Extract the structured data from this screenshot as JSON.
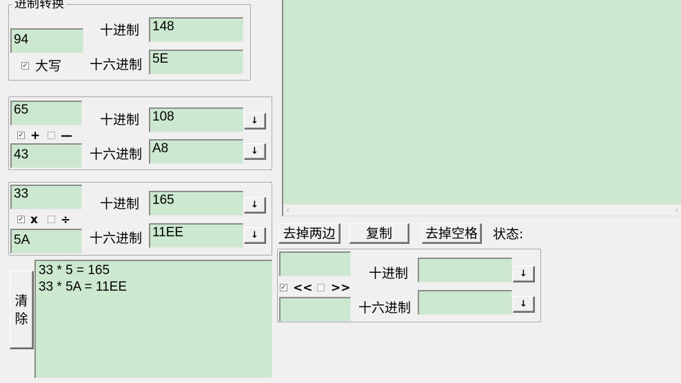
{
  "group1": {
    "title": "进制转换",
    "input": "94",
    "uppercase_checked": true,
    "uppercase_label": "大写",
    "decimal_label": "十进制",
    "decimal_value": "148",
    "hex_label": "十六进制",
    "hex_value": "5E"
  },
  "group2": {
    "input_a": "65",
    "input_b": "43",
    "plus_checked": true,
    "plus_label": "+",
    "minus_checked": false,
    "minus_label": "—",
    "decimal_label": "十进制",
    "decimal_value": "108",
    "hex_label": "十六进制",
    "hex_value": "A8",
    "down_label": "↓"
  },
  "group3": {
    "input_a": "33",
    "input_b": "5A",
    "mul_checked": true,
    "mul_label": "x",
    "div_checked": false,
    "div_label": "÷",
    "decimal_label": "十进制",
    "decimal_value": "165",
    "hex_label": "十六进制",
    "hex_value": "11EE",
    "down_label": "↓"
  },
  "log": {
    "clear_label_1": "清",
    "clear_label_2": "除",
    "text": "33 * 5 = 165\n33 * 5A = 11EE"
  },
  "right_panel": {
    "scroll_left": "‹",
    "scroll_right": "›"
  },
  "toolbar": {
    "strip_edges_label": "去掉两边",
    "copy_label": "复制",
    "strip_spaces_label": "去掉空格",
    "status_label": "状态:"
  },
  "group4": {
    "input_a": "",
    "input_b": "",
    "shl_checked": true,
    "shl_label": "<<",
    "shr_checked": false,
    "shr_label": ">>",
    "decimal_label": "十进制",
    "decimal_value": "",
    "hex_label": "十六进制",
    "hex_value": "",
    "down_label": "↓"
  },
  "checkmark": "✓",
  "colors": {
    "field_bg": "#cce8cf",
    "window_bg": "#f0f0f0"
  }
}
